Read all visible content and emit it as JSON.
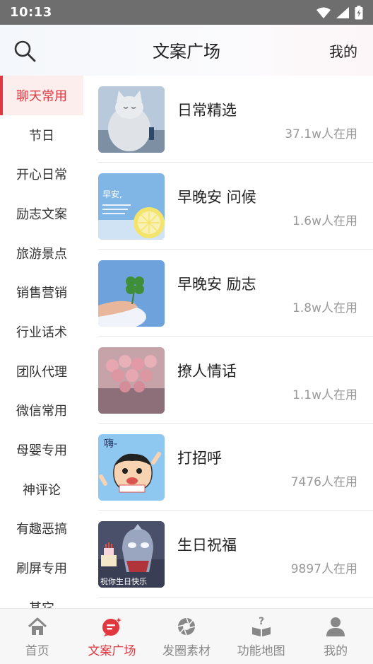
{
  "status_bar": {
    "time": "10:13"
  },
  "header": {
    "title": "文案广场",
    "right_link": "我的"
  },
  "sidebar": {
    "items": [
      {
        "label": "聊天常用",
        "active": true
      },
      {
        "label": "节日"
      },
      {
        "label": "开心日常"
      },
      {
        "label": "励志文案"
      },
      {
        "label": "旅游景点"
      },
      {
        "label": "销售营销"
      },
      {
        "label": "行业话术"
      },
      {
        "label": "团队代理"
      },
      {
        "label": "微信常用"
      },
      {
        "label": "母婴专用"
      },
      {
        "label": "神评论"
      },
      {
        "label": "有趣恶搞"
      },
      {
        "label": "刷屏专用"
      },
      {
        "label": "其它"
      }
    ]
  },
  "list": {
    "items": [
      {
        "title": "日常精选",
        "count": "37.1w人在用"
      },
      {
        "title": "早晚安 问候",
        "count": "1.6w人在用",
        "thumb_text": "早安,"
      },
      {
        "title": "早晚安 励志",
        "count": "1.8w人在用"
      },
      {
        "title": "撩人情话",
        "count": "1.1w人在用"
      },
      {
        "title": "打招呼",
        "count": "7476人在用",
        "thumb_text": "嗨-"
      },
      {
        "title": "生日祝福",
        "count": "9897人在用",
        "thumb_text": "祝你生日快乐"
      }
    ]
  },
  "bottom_nav": {
    "items": [
      {
        "label": "首页",
        "icon": "home-icon"
      },
      {
        "label": "文案广场",
        "icon": "chat-bubble-icon",
        "active": true
      },
      {
        "label": "发圈素材",
        "icon": "aperture-icon"
      },
      {
        "label": "功能地图",
        "icon": "help-book-icon"
      },
      {
        "label": "我的",
        "icon": "user-icon"
      }
    ]
  },
  "colors": {
    "accent": "#e2373f",
    "inactive": "#888888",
    "status_bar": "#6e6e6e"
  }
}
